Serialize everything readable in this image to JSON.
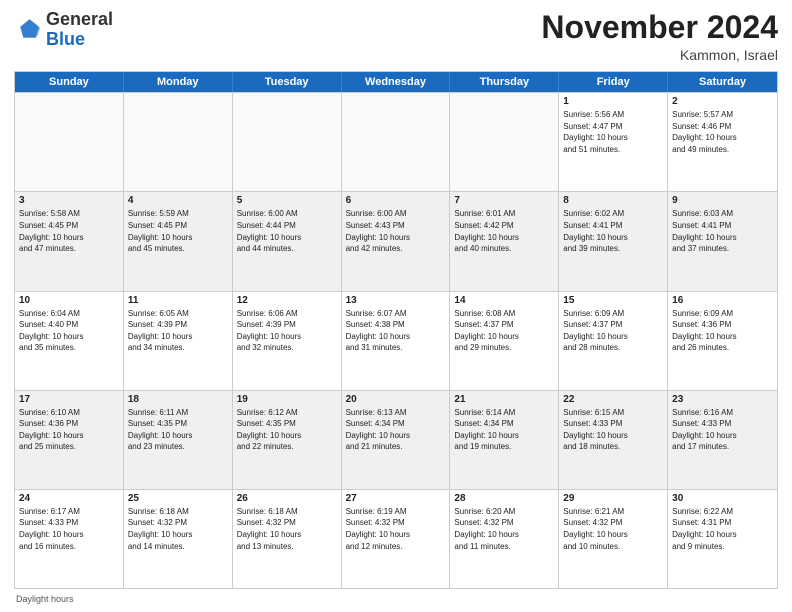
{
  "logo": {
    "general": "General",
    "blue": "Blue"
  },
  "header": {
    "month": "November 2024",
    "location": "Kammon, Israel"
  },
  "days": [
    "Sunday",
    "Monday",
    "Tuesday",
    "Wednesday",
    "Thursday",
    "Friday",
    "Saturday"
  ],
  "footer": "Daylight hours",
  "weeks": [
    [
      {
        "day": "",
        "empty": true,
        "text": ""
      },
      {
        "day": "",
        "empty": true,
        "text": ""
      },
      {
        "day": "",
        "empty": true,
        "text": ""
      },
      {
        "day": "",
        "empty": true,
        "text": ""
      },
      {
        "day": "",
        "empty": true,
        "text": ""
      },
      {
        "day": "1",
        "text": "Sunrise: 5:56 AM\nSunset: 4:47 PM\nDaylight: 10 hours\nand 51 minutes."
      },
      {
        "day": "2",
        "text": "Sunrise: 5:57 AM\nSunset: 4:46 PM\nDaylight: 10 hours\nand 49 minutes."
      }
    ],
    [
      {
        "day": "3",
        "text": "Sunrise: 5:58 AM\nSunset: 4:45 PM\nDaylight: 10 hours\nand 47 minutes."
      },
      {
        "day": "4",
        "text": "Sunrise: 5:59 AM\nSunset: 4:45 PM\nDaylight: 10 hours\nand 45 minutes."
      },
      {
        "day": "5",
        "text": "Sunrise: 6:00 AM\nSunset: 4:44 PM\nDaylight: 10 hours\nand 44 minutes."
      },
      {
        "day": "6",
        "text": "Sunrise: 6:00 AM\nSunset: 4:43 PM\nDaylight: 10 hours\nand 42 minutes."
      },
      {
        "day": "7",
        "text": "Sunrise: 6:01 AM\nSunset: 4:42 PM\nDaylight: 10 hours\nand 40 minutes."
      },
      {
        "day": "8",
        "text": "Sunrise: 6:02 AM\nSunset: 4:41 PM\nDaylight: 10 hours\nand 39 minutes."
      },
      {
        "day": "9",
        "text": "Sunrise: 6:03 AM\nSunset: 4:41 PM\nDaylight: 10 hours\nand 37 minutes."
      }
    ],
    [
      {
        "day": "10",
        "text": "Sunrise: 6:04 AM\nSunset: 4:40 PM\nDaylight: 10 hours\nand 35 minutes."
      },
      {
        "day": "11",
        "text": "Sunrise: 6:05 AM\nSunset: 4:39 PM\nDaylight: 10 hours\nand 34 minutes."
      },
      {
        "day": "12",
        "text": "Sunrise: 6:06 AM\nSunset: 4:39 PM\nDaylight: 10 hours\nand 32 minutes."
      },
      {
        "day": "13",
        "text": "Sunrise: 6:07 AM\nSunset: 4:38 PM\nDaylight: 10 hours\nand 31 minutes."
      },
      {
        "day": "14",
        "text": "Sunrise: 6:08 AM\nSunset: 4:37 PM\nDaylight: 10 hours\nand 29 minutes."
      },
      {
        "day": "15",
        "text": "Sunrise: 6:09 AM\nSunset: 4:37 PM\nDaylight: 10 hours\nand 28 minutes."
      },
      {
        "day": "16",
        "text": "Sunrise: 6:09 AM\nSunset: 4:36 PM\nDaylight: 10 hours\nand 26 minutes."
      }
    ],
    [
      {
        "day": "17",
        "text": "Sunrise: 6:10 AM\nSunset: 4:36 PM\nDaylight: 10 hours\nand 25 minutes."
      },
      {
        "day": "18",
        "text": "Sunrise: 6:11 AM\nSunset: 4:35 PM\nDaylight: 10 hours\nand 23 minutes."
      },
      {
        "day": "19",
        "text": "Sunrise: 6:12 AM\nSunset: 4:35 PM\nDaylight: 10 hours\nand 22 minutes."
      },
      {
        "day": "20",
        "text": "Sunrise: 6:13 AM\nSunset: 4:34 PM\nDaylight: 10 hours\nand 21 minutes."
      },
      {
        "day": "21",
        "text": "Sunrise: 6:14 AM\nSunset: 4:34 PM\nDaylight: 10 hours\nand 19 minutes."
      },
      {
        "day": "22",
        "text": "Sunrise: 6:15 AM\nSunset: 4:33 PM\nDaylight: 10 hours\nand 18 minutes."
      },
      {
        "day": "23",
        "text": "Sunrise: 6:16 AM\nSunset: 4:33 PM\nDaylight: 10 hours\nand 17 minutes."
      }
    ],
    [
      {
        "day": "24",
        "text": "Sunrise: 6:17 AM\nSunset: 4:33 PM\nDaylight: 10 hours\nand 16 minutes."
      },
      {
        "day": "25",
        "text": "Sunrise: 6:18 AM\nSunset: 4:32 PM\nDaylight: 10 hours\nand 14 minutes."
      },
      {
        "day": "26",
        "text": "Sunrise: 6:18 AM\nSunset: 4:32 PM\nDaylight: 10 hours\nand 13 minutes."
      },
      {
        "day": "27",
        "text": "Sunrise: 6:19 AM\nSunset: 4:32 PM\nDaylight: 10 hours\nand 12 minutes."
      },
      {
        "day": "28",
        "text": "Sunrise: 6:20 AM\nSunset: 4:32 PM\nDaylight: 10 hours\nand 11 minutes."
      },
      {
        "day": "29",
        "text": "Sunrise: 6:21 AM\nSunset: 4:32 PM\nDaylight: 10 hours\nand 10 minutes."
      },
      {
        "day": "30",
        "text": "Sunrise: 6:22 AM\nSunset: 4:31 PM\nDaylight: 10 hours\nand 9 minutes."
      }
    ]
  ]
}
